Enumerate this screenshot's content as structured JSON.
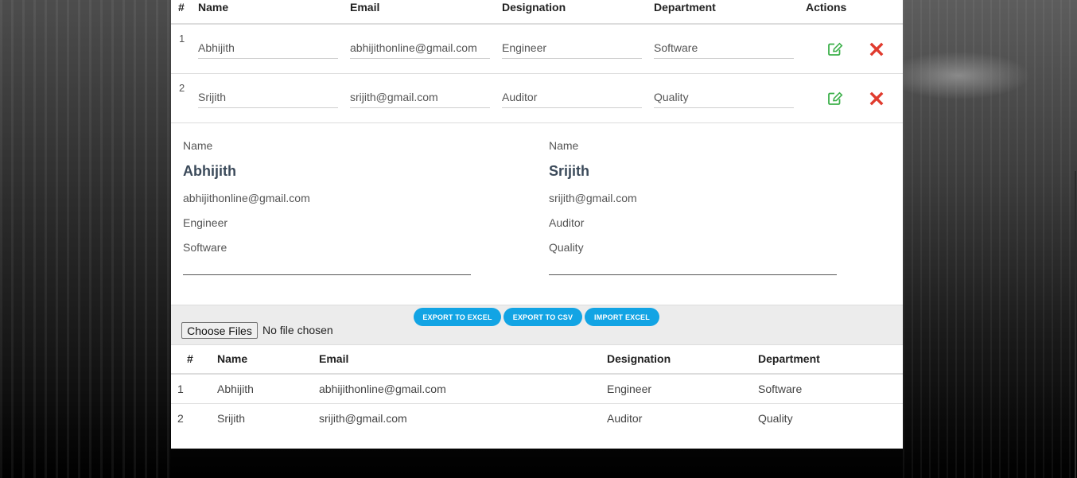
{
  "edit_table": {
    "headers": [
      "#",
      "Name",
      "Email",
      "Designation",
      "Department",
      "Actions"
    ],
    "rows": [
      {
        "index": "1",
        "name": "Abhijith",
        "email": "abhijithonline@gmail.com",
        "designation": "Engineer",
        "department": "Software"
      },
      {
        "index": "2",
        "name": "Srijith",
        "email": "srijith@gmail.com",
        "designation": "Auditor",
        "department": "Quality"
      }
    ]
  },
  "cards": [
    {
      "label": "Name",
      "name": "Abhijith",
      "email": "abhijithonline@gmail.com",
      "designation": "Engineer",
      "department": "Software"
    },
    {
      "label": "Name",
      "name": "Srijith",
      "email": "srijith@gmail.com",
      "designation": "Auditor",
      "department": "Quality"
    }
  ],
  "toolbar": {
    "export_excel": "EXPORT TO EXCEL",
    "export_csv": "EXPORT TO CSV",
    "import_excel": "IMPORT EXCEL",
    "choose_files": "Choose Files",
    "no_file": "No file chosen"
  },
  "data_table": {
    "headers": [
      "#",
      "Name",
      "Email",
      "Designation",
      "Department"
    ],
    "rows": [
      {
        "index": "1",
        "name": "Abhijith",
        "email": "abhijithonline@gmail.com",
        "designation": "Engineer",
        "department": "Software"
      },
      {
        "index": "2",
        "name": "Srijith",
        "email": "srijith@gmail.com",
        "designation": "Auditor",
        "department": "Quality"
      }
    ]
  },
  "colors": {
    "accent_button": "#12a4e4",
    "edit_icon": "#3cb04a",
    "delete_icon": "#e03b2e"
  },
  "icons": {
    "edit": "edit-icon",
    "delete": "delete-icon"
  }
}
